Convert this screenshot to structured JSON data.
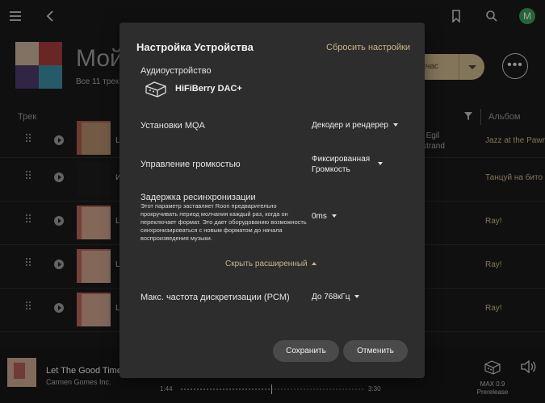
{
  "app": {
    "page_title": "Мой",
    "page_subtitle": "Все 11 трек",
    "play_now_label": "ейчас",
    "more_label": "•••",
    "avatar_letter": "M",
    "columns": {
      "track": "Трек",
      "album": "Альбом"
    }
  },
  "rows": [
    {
      "title": "L",
      "artist": "berg, Egil\nrs Erstrand",
      "album": "Jazz at the Pawn"
    },
    {
      "title": "И",
      "artist": "",
      "album": "Танцуй на бито"
    },
    {
      "title": "L",
      "artist": "",
      "album": "Ray!"
    },
    {
      "title": "L",
      "artist": "",
      "album": "Ray!"
    },
    {
      "title": "L",
      "artist": "",
      "album": "Ray!"
    }
  ],
  "now_playing": {
    "title": "Let The Good Time",
    "artist": "Carmen Gomes Inc.",
    "elapsed": "1:44",
    "total": "3:30",
    "progress": 0.495,
    "device_line1": "MAX 0.9",
    "device_line2": "Prerelease"
  },
  "modal": {
    "title": "Настройка Устройства",
    "reset_label": "Сбросить настройки",
    "audio_device_label": "Аудиоустройство",
    "device_name": "HiFiBerry DAC+",
    "mqa_label": "Установки MQA",
    "mqa_value": "Декодер и рендерер",
    "volume_label": "Управление громкостью",
    "volume_value_line1": "Фиксированная",
    "volume_value_line2": "Громкость",
    "resync_label": "Задержка ресинхронизации",
    "resync_desc": "Этот параметр заставляет Roon предварительно прокручивать период молчания каждый раз, когда он переключает формат. Это дает оборудованию возможность синхронизироваться с новым форматом до начала воспроизведения музыки.",
    "resync_value": "0ms",
    "hide_advanced_label": "Скрыть расширенный",
    "max_rate_label": "Макс. частота дискретизации (PCM)",
    "max_rate_value": "До 768кГц",
    "save_label": "Сохранить",
    "cancel_label": "Отменить"
  },
  "colors": {
    "accent": "#c9b48a",
    "modal_bg": "#2d2d2d",
    "button_bg": "#4a4a4a",
    "avatar_bg": "#3a9a5a"
  }
}
